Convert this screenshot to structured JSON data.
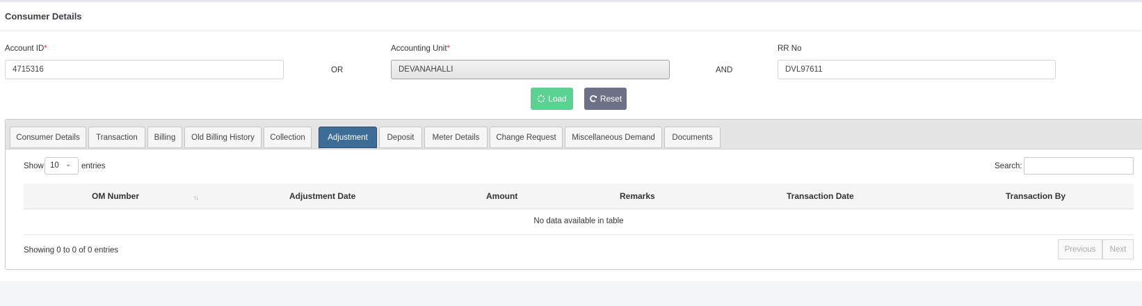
{
  "card": {
    "title": "Consumer Details"
  },
  "form": {
    "account_id": {
      "label": "Account ID",
      "required": "*",
      "value": "4715316"
    },
    "or_text": "OR",
    "accounting_unit": {
      "label": "Accounting Unit",
      "required": "*",
      "value": "DEVANAHALLI"
    },
    "and_text": "AND",
    "rr_no": {
      "label": "RR No",
      "value": "DVL97611"
    },
    "load_button": {
      "label": "Load",
      "icon": "spinner-icon",
      "color": "#5bd192"
    },
    "reset_button": {
      "label": "Reset",
      "icon": "refresh-icon",
      "color": "#6e7087"
    }
  },
  "tabs": [
    {
      "label": "Consumer Details"
    },
    {
      "label": "Transaction"
    },
    {
      "label": "Billing"
    },
    {
      "label": "Old Billing History"
    },
    {
      "label": "Collection"
    },
    {
      "label": "Adjustment",
      "active": true
    },
    {
      "label": "Deposit"
    },
    {
      "label": "Meter Details"
    },
    {
      "label": "Change Request"
    },
    {
      "label": "Miscellaneous Demand"
    },
    {
      "label": "Documents"
    }
  ],
  "table_controls": {
    "show_label": "Show",
    "entries_value": "10",
    "entries_label": "entries",
    "search_label": "Search:",
    "search_value": ""
  },
  "table": {
    "columns": [
      "OM Number",
      "Adjustment Date",
      "Amount",
      "Remarks",
      "Transaction Date",
      "Transaction By"
    ],
    "empty_message": "No data available in table",
    "info": "Showing 0 to 0 of 0 entries"
  },
  "pagination": {
    "previous": "Previous",
    "next": "Next"
  },
  "colors": {
    "active_tab": "#3d6d97",
    "required": "#dc3545"
  }
}
